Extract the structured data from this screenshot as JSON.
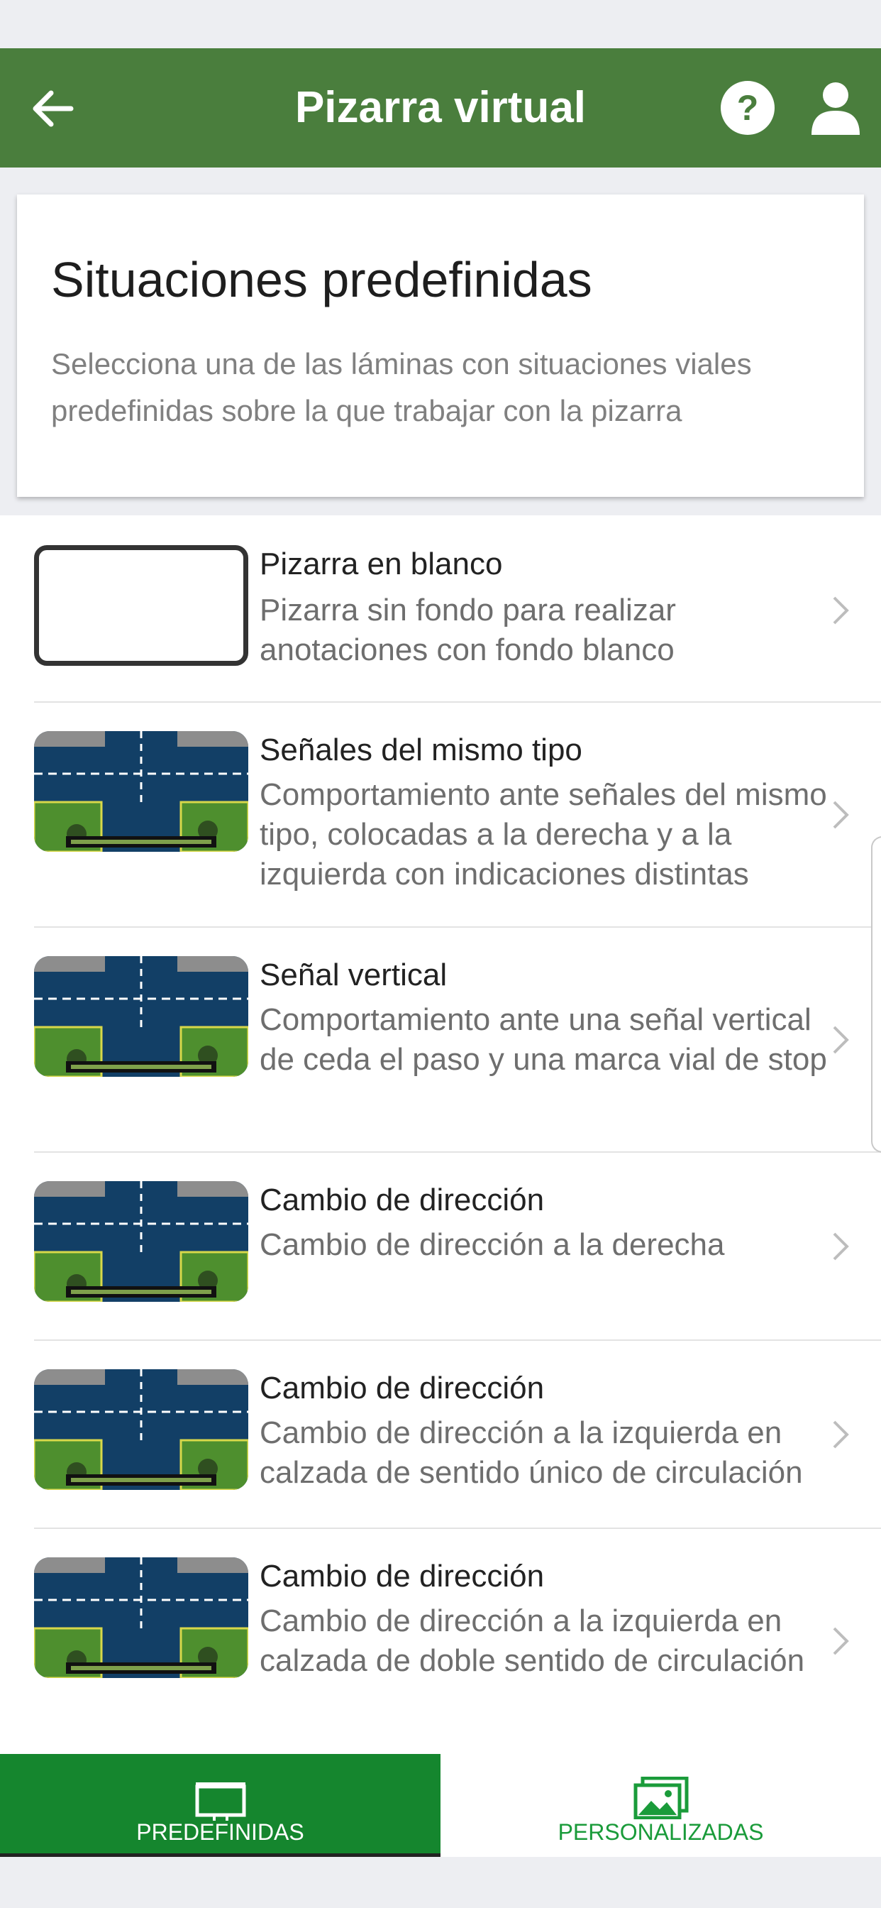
{
  "app_bar": {
    "title": "Pizarra virtual",
    "back_icon": "arrow-left-icon",
    "help_icon": "help-circle-icon",
    "user_icon": "user-icon",
    "background": "#4a7e3d"
  },
  "intro": {
    "title": "Situaciones predefinidas",
    "description": "Selecciona una de las láminas con situaciones viales predefinidas sobre la que trabajar con la pizarra"
  },
  "items": [
    {
      "title": "Pizarra en blanco",
      "description": "Pizarra sin fondo para realizar anotaciones con fondo blanco",
      "thumbnail": "blank-board"
    },
    {
      "title": "Señales del mismo tipo",
      "description": "Comportamiento ante señales del mismo tipo, colocadas a la derecha y a la izquierda con indicaciones distintas",
      "thumbnail": "intersection-scene"
    },
    {
      "title": "Señal vertical",
      "description": "Comportamiento ante una señal vertical de ceda el paso y una marca vial de stop",
      "thumbnail": "intersection-scene"
    },
    {
      "title": "Cambio de dirección",
      "description": "Cambio de dirección a la derecha",
      "thumbnail": "intersection-scene"
    },
    {
      "title": "Cambio de dirección",
      "description": "Cambio de dirección a la izquierda en calzada de sentido único de circulación",
      "thumbnail": "intersection-scene"
    },
    {
      "title": "Cambio de dirección",
      "description": "Cambio de dirección a la izquierda en calzada de doble sentido de circulación",
      "thumbnail": "intersection-scene"
    }
  ],
  "bottom_nav": {
    "tabs": [
      {
        "label": "PREDEFINIDAS",
        "icon": "whiteboard-icon",
        "selected": true
      },
      {
        "label": "PERSONALIZADAS",
        "icon": "images-icon",
        "selected": false
      }
    ],
    "selected_color": "#15862e"
  }
}
